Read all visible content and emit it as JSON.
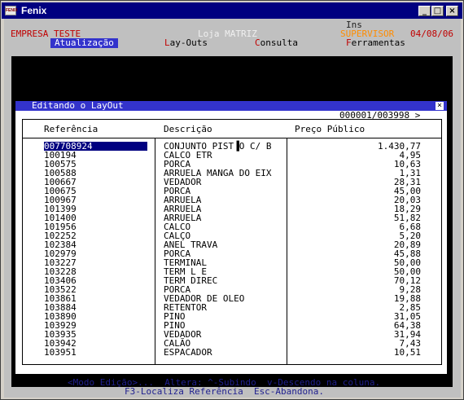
{
  "window": {
    "title": "Fenix",
    "icon_label": "FENIX"
  },
  "header": {
    "ins_indicator": "Ins",
    "company": "EMPRESA TESTE",
    "store": "Loja MATRIZ",
    "user": "SUPERVISOR",
    "date": "04/08/06"
  },
  "menu": [
    {
      "label": "Atualização",
      "selected": true
    },
    {
      "hot": "L",
      "rest": "ay-Outs",
      "selected": false
    },
    {
      "hot": "C",
      "rest": "onsulta",
      "selected": false
    },
    {
      "hot": "F",
      "rest": "erramentas",
      "selected": false
    }
  ],
  "dialog": {
    "title": "Editando o LayOut",
    "close": "×",
    "counter": "000001/003998",
    "arrow": ">",
    "columns": {
      "ref": "Referência",
      "desc": "Descrição",
      "price": "Preço Público"
    }
  },
  "rows": [
    {
      "ref": "007708924",
      "desc": "CONJUNTO PIST▐O C/ B",
      "price": "1.430,77"
    },
    {
      "ref": "100194",
      "desc": "CALCO ETR",
      "price": "4,95"
    },
    {
      "ref": "100575",
      "desc": "PORCA",
      "price": "10,63"
    },
    {
      "ref": "100588",
      "desc": "ARRUELA MANGA DO EIX",
      "price": "1,31"
    },
    {
      "ref": "100667",
      "desc": "VEDADOR",
      "price": "28,31"
    },
    {
      "ref": "100675",
      "desc": "PORCA",
      "price": "45,00"
    },
    {
      "ref": "100967",
      "desc": "ARRUELA",
      "price": "20,03"
    },
    {
      "ref": "101399",
      "desc": "ARRUELA",
      "price": "18,29"
    },
    {
      "ref": "101400",
      "desc": "ARRUELA",
      "price": "51,82"
    },
    {
      "ref": "101956",
      "desc": "CALCO",
      "price": "6,68"
    },
    {
      "ref": "102252",
      "desc": "CALÇO",
      "price": "5,20"
    },
    {
      "ref": "102384",
      "desc": "ANEL TRAVA",
      "price": "20,89"
    },
    {
      "ref": "102979",
      "desc": "PORCA",
      "price": "45,88"
    },
    {
      "ref": "103227",
      "desc": "TERMINAL",
      "price": "50,00"
    },
    {
      "ref": "103228",
      "desc": "TERM L E",
      "price": "50,00"
    },
    {
      "ref": "103406",
      "desc": "TERM DIREC",
      "price": "70,12"
    },
    {
      "ref": "103522",
      "desc": "PORCA",
      "price": "9,28"
    },
    {
      "ref": "103861",
      "desc": "VEDADOR DE OLEO",
      "price": "19,88"
    },
    {
      "ref": "103884",
      "desc": "RETENTOR",
      "price": "2,85"
    },
    {
      "ref": "103890",
      "desc": "PINO",
      "price": "31,05"
    },
    {
      "ref": "103929",
      "desc": "PINO",
      "price": "64,38"
    },
    {
      "ref": "103935",
      "desc": "VEDADOR",
      "price": "31,94"
    },
    {
      "ref": "103942",
      "desc": "CALÃO",
      "price": "7,43"
    },
    {
      "ref": "103951",
      "desc": "ESPACADOR",
      "price": "10,51"
    }
  ],
  "footer": {
    "line1": "<Modo Edição>...  Altera: ^-Subindo  v-Descendo na coluna.",
    "line2": "F3-Localiza Referência  Esc-Abandona."
  },
  "colors": {
    "titlebar": "#000080",
    "menu_highlight": "#3333cc",
    "red_text": "#c00000",
    "footer_text": "#1f1f8f",
    "user_text": "#ff8c00"
  }
}
